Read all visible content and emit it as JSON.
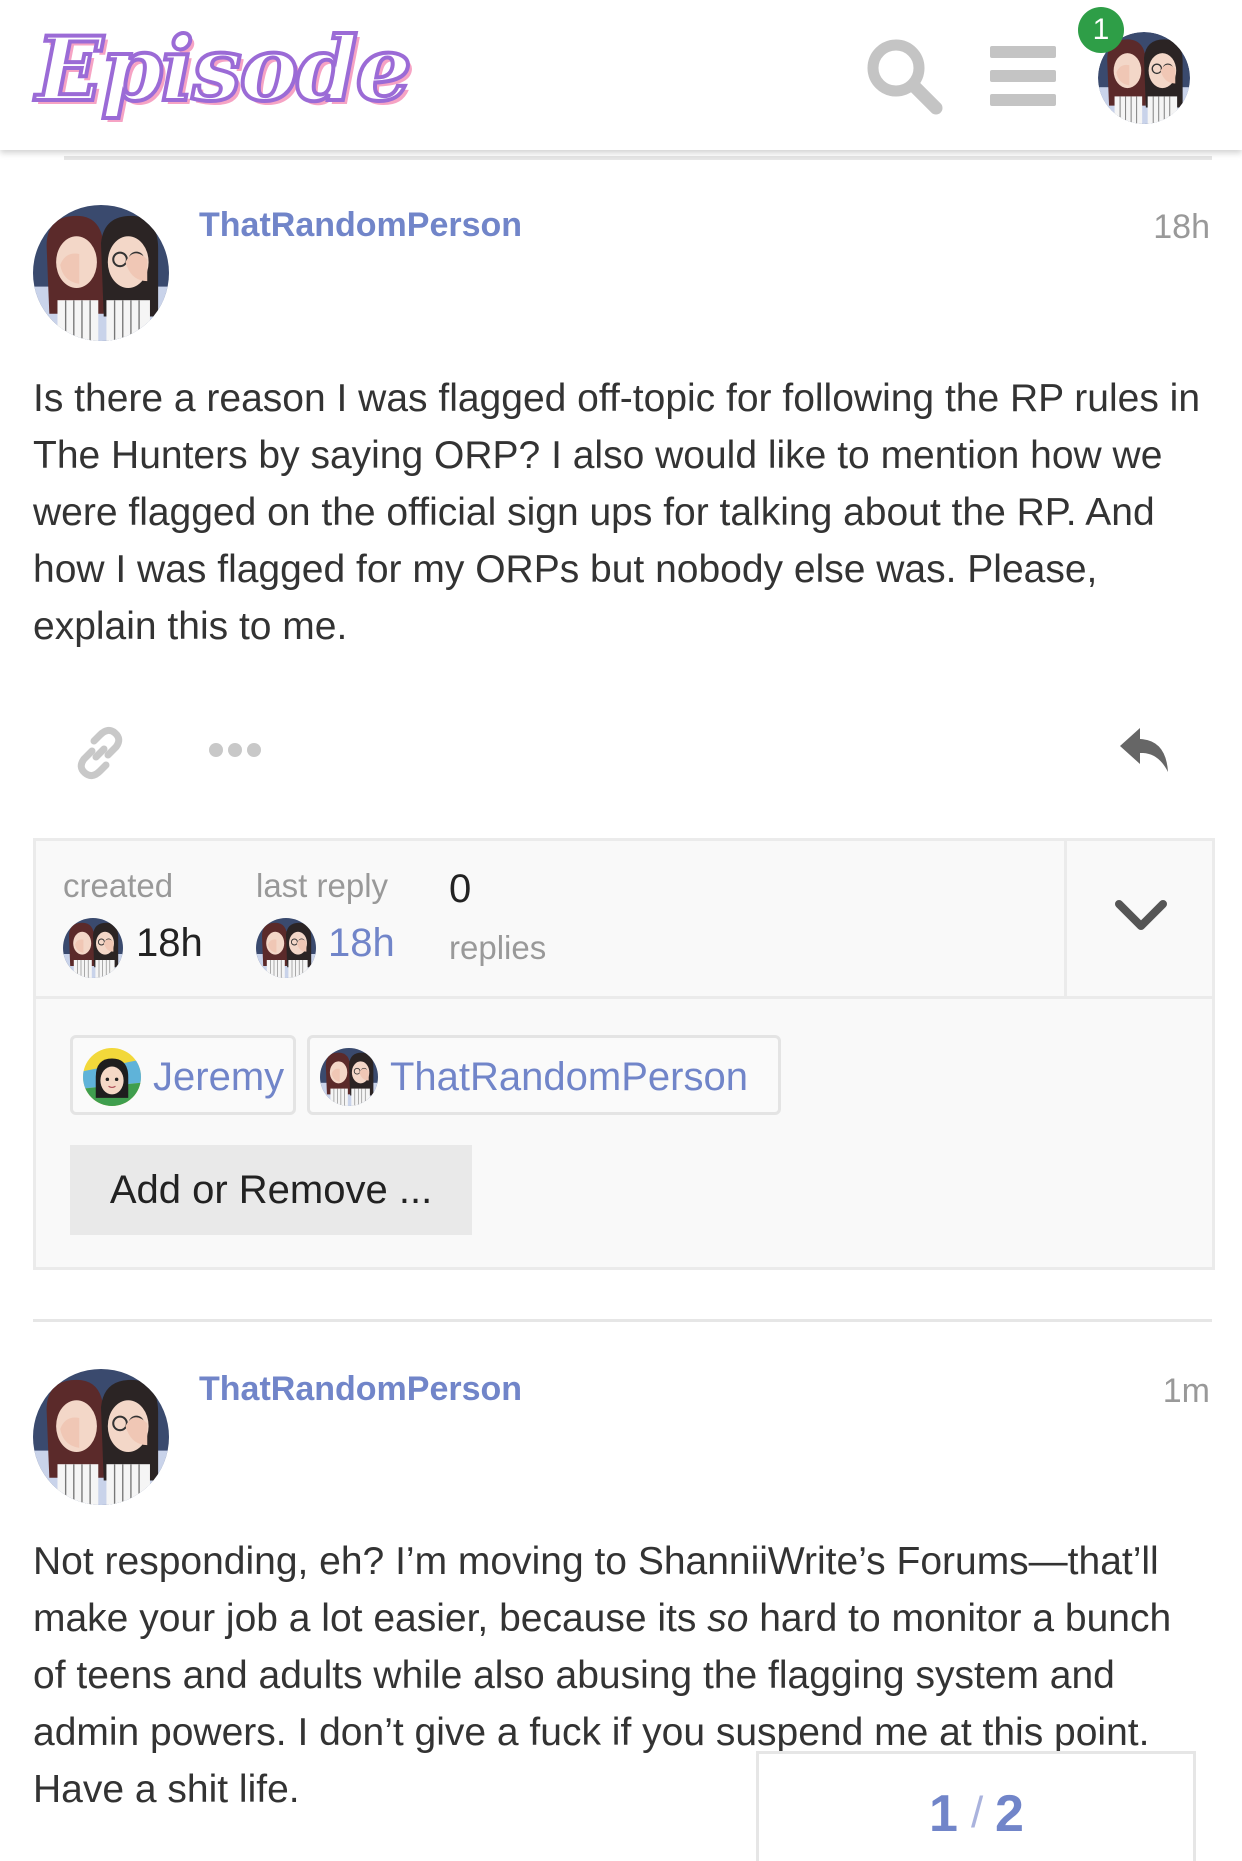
{
  "header": {
    "logo_text": "Episode",
    "notification_count": "1",
    "icons": [
      "search-icon",
      "hamburger-menu-icon",
      "user-avatar-icon"
    ]
  },
  "posts": [
    {
      "username": "ThatRandomPerson",
      "time": "18h",
      "body": "Is there a reason I was flagged off-topic for following the RP rules in The Hunters by saying ORP? I also would like to mention how we were flagged on the official sign ups for talking about the RP. And how I was flagged for my ORPs but nobody else was. Please, explain this to me."
    },
    {
      "username": "ThatRandomPerson",
      "time": "1m",
      "body_before": "Not responding, eh? I’m moving to ShanniiWrite’s Forums—that’ll make your job a lot easier, because its ",
      "body_emph": "so",
      "body_after": " hard to monitor a bunch of teens and adults while also abusing the flagging system and admin powers. I don’t give a fuck if you suspend me at this point. Have a shit life."
    }
  ],
  "actions": {
    "icons": [
      "link-icon",
      "more-options-icon",
      "reply-icon"
    ]
  },
  "summary": {
    "created_label": "created",
    "created_value": "18h",
    "last_reply_label": "last reply",
    "last_reply_value": "18h",
    "replies_count": "0",
    "replies_label": "replies",
    "participants": [
      "Jeremy",
      "ThatRandomPerson"
    ],
    "add_remove_label": "Add or Remove ..."
  },
  "pager": {
    "current": "1",
    "separator": "/",
    "total": "2"
  },
  "colors": {
    "accent": "#7185c9",
    "badge": "#2e9e47",
    "muted": "#999999"
  }
}
